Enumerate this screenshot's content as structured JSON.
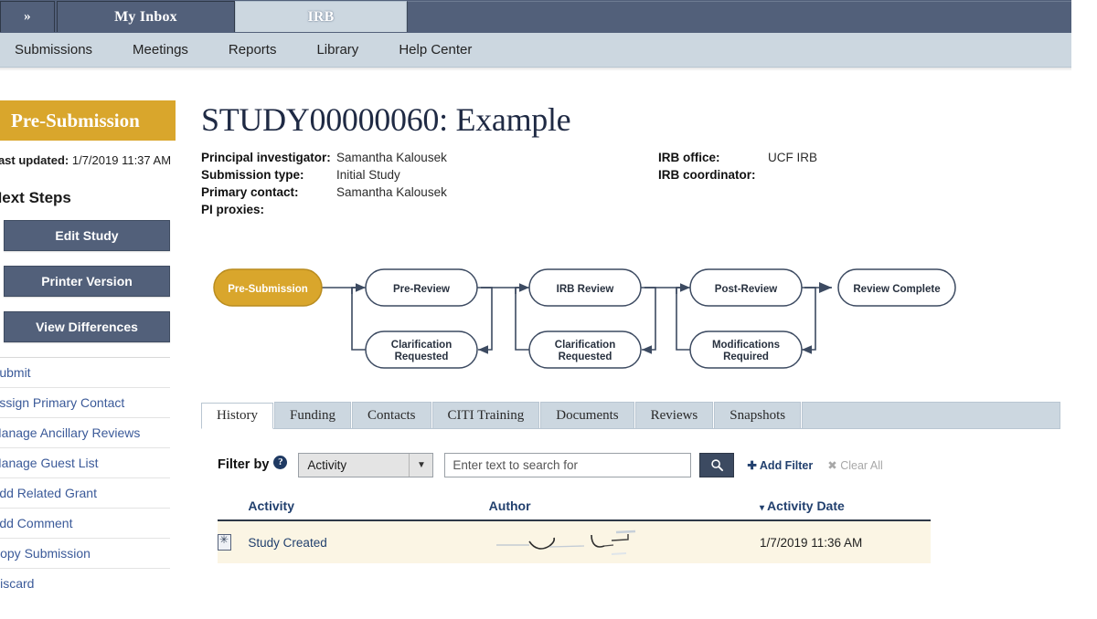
{
  "topbar": {
    "chevron_label": "»",
    "tabs": [
      {
        "label": "My Inbox",
        "active": false
      },
      {
        "label": "IRB",
        "active": true
      }
    ]
  },
  "nav": {
    "items": [
      {
        "label": "Submissions"
      },
      {
        "label": "Meetings"
      },
      {
        "label": "Reports"
      },
      {
        "label": "Library"
      },
      {
        "label": "Help Center"
      }
    ]
  },
  "sidebar": {
    "status": "Pre-Submission",
    "status_color": "#d9a62c",
    "last_updated_label": "Last updated:",
    "last_updated_value": "1/7/2019 11:37 AM",
    "next_steps_header": "Next Steps",
    "buttons": [
      {
        "label": "Edit Study"
      },
      {
        "label": "Printer Version"
      },
      {
        "label": "View Differences"
      }
    ],
    "links": [
      {
        "label": "Submit"
      },
      {
        "label": "Assign Primary Contact"
      },
      {
        "label": "Manage Ancillary Reviews"
      },
      {
        "label": "Manage Guest List"
      },
      {
        "label": "Add Related Grant"
      },
      {
        "label": "Add Comment"
      },
      {
        "label": "Copy Submission"
      },
      {
        "label": "Discard"
      }
    ]
  },
  "header": {
    "title": "STUDY00000060: Example",
    "meta_left": [
      {
        "label": "Principal investigator:",
        "value": "Samantha Kalousek"
      },
      {
        "label": "Submission type:",
        "value": "Initial Study"
      },
      {
        "label": "Primary contact:",
        "value": "Samantha Kalousek"
      },
      {
        "label": "PI proxies:",
        "value": ""
      }
    ],
    "meta_right": [
      {
        "label": "IRB office:",
        "value": "UCF IRB"
      },
      {
        "label": "IRB coordinator:",
        "value": ""
      }
    ]
  },
  "workflow": {
    "active_state": "Pre-Submission",
    "active_color": "#d9a62c",
    "stages": [
      {
        "label": "Pre-Submission",
        "sub": null
      },
      {
        "label": "Pre-Review",
        "sub": "Clarification Requested"
      },
      {
        "label": "IRB Review",
        "sub": "Clarification Requested"
      },
      {
        "label": "Post-Review",
        "sub": "Modifications Required"
      },
      {
        "label": "Review Complete",
        "sub": null
      }
    ]
  },
  "panel": {
    "tabs": [
      {
        "label": "History",
        "active": true
      },
      {
        "label": "Funding",
        "active": false
      },
      {
        "label": "Contacts",
        "active": false
      },
      {
        "label": "CITI Training",
        "active": false
      },
      {
        "label": "Documents",
        "active": false
      },
      {
        "label": "Reviews",
        "active": false
      },
      {
        "label": "Snapshots",
        "active": false
      }
    ],
    "filter": {
      "label": "Filter by",
      "help_icon": "question-mark-icon",
      "select_value": "Activity",
      "select_options": [
        "Activity"
      ],
      "search_placeholder": "Enter text to search for",
      "search_value": "",
      "search_icon": "magnifier-icon",
      "add_filter_label": "Add Filter",
      "clear_all_label": "Clear All"
    },
    "table": {
      "columns": [
        "",
        "Activity",
        "Author",
        "Activity Date"
      ],
      "sorted_column": "Activity Date",
      "sort_caret": "▾",
      "rows": [
        {
          "icon": "document-icon",
          "activity": "Study Created",
          "author": "",
          "author_redacted": true,
          "date": "1/7/2019 11:36 AM"
        }
      ]
    }
  }
}
